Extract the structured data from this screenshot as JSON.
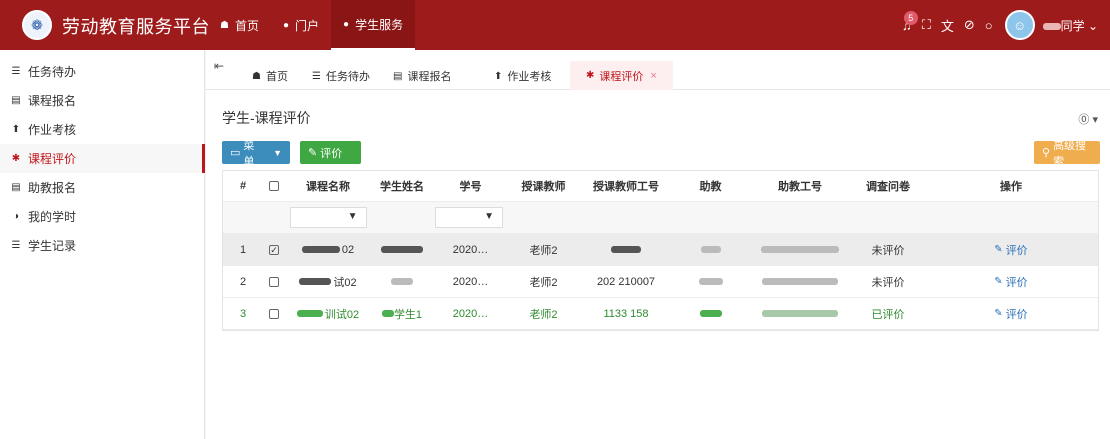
{
  "app": {
    "title": "劳动教育服务平台",
    "logo_icon": "university-seal-icon"
  },
  "nav": [
    {
      "label": "首页",
      "icon": "home-icon"
    },
    {
      "label": "门户",
      "icon": "portal-icon"
    },
    {
      "label": "学生服务",
      "icon": "student-service-icon",
      "active": true
    }
  ],
  "top_right": {
    "notification_count": "5",
    "user_name": "同学"
  },
  "sidebar": {
    "items": [
      {
        "label": "任务待办",
        "icon": "list-icon"
      },
      {
        "label": "课程报名",
        "icon": "id-card-icon"
      },
      {
        "label": "作业考核",
        "icon": "upload-icon"
      },
      {
        "label": "课程评价",
        "icon": "asterisk-icon",
        "active": true
      },
      {
        "label": "助教报名",
        "icon": "id-card-icon"
      },
      {
        "label": "我的学时",
        "icon": "half-circle-icon"
      },
      {
        "label": "学生记录",
        "icon": "list-icon"
      }
    ]
  },
  "tabs": [
    {
      "label": "首页",
      "icon": "home-icon"
    },
    {
      "label": "任务待办",
      "icon": "list-icon"
    },
    {
      "label": "课程报名",
      "icon": "id-card-icon"
    },
    {
      "label": "作业考核",
      "icon": "upload-icon"
    },
    {
      "label": "课程评价",
      "icon": "asterisk-icon",
      "active": true
    }
  ],
  "page": {
    "title": "学生-课程评价",
    "menu_button": "菜单",
    "eval_button": "评价",
    "search_button": "高级搜索"
  },
  "table": {
    "columns": [
      "#",
      "",
      "课程名称",
      "学生姓名",
      "学号",
      "授课教师",
      "授课教师工号",
      "助教",
      "助教工号",
      "调查问卷",
      "操作"
    ],
    "rows": [
      {
        "index": "1",
        "checked": true,
        "course": "02",
        "student": "",
        "student_id": "2020…",
        "teacher": "老师2",
        "teacher_id": "",
        "assistant": "",
        "assistant_id": "",
        "survey": "未评价",
        "action": "评价",
        "selected": true
      },
      {
        "index": "2",
        "checked": false,
        "course": "试02",
        "student": "",
        "student_id": "2020…",
        "teacher": "老师2",
        "teacher_id": "202 210007",
        "assistant": "",
        "assistant_id": "",
        "survey": "未评价",
        "action": "评价"
      },
      {
        "index": "3",
        "checked": false,
        "course": "训试02",
        "student": "学生1",
        "student_id": "2020…",
        "teacher": "老师2",
        "teacher_id": "1133 158",
        "assistant": "",
        "assistant_id": "",
        "survey": "已评价",
        "action": "评价",
        "green": true
      }
    ]
  },
  "colors": {
    "topbar": "#9e1b1b",
    "active": "#c0161b",
    "menu_button": "#3c8dbc",
    "eval_button": "#3fa842",
    "search_button": "#f0ad4e"
  }
}
